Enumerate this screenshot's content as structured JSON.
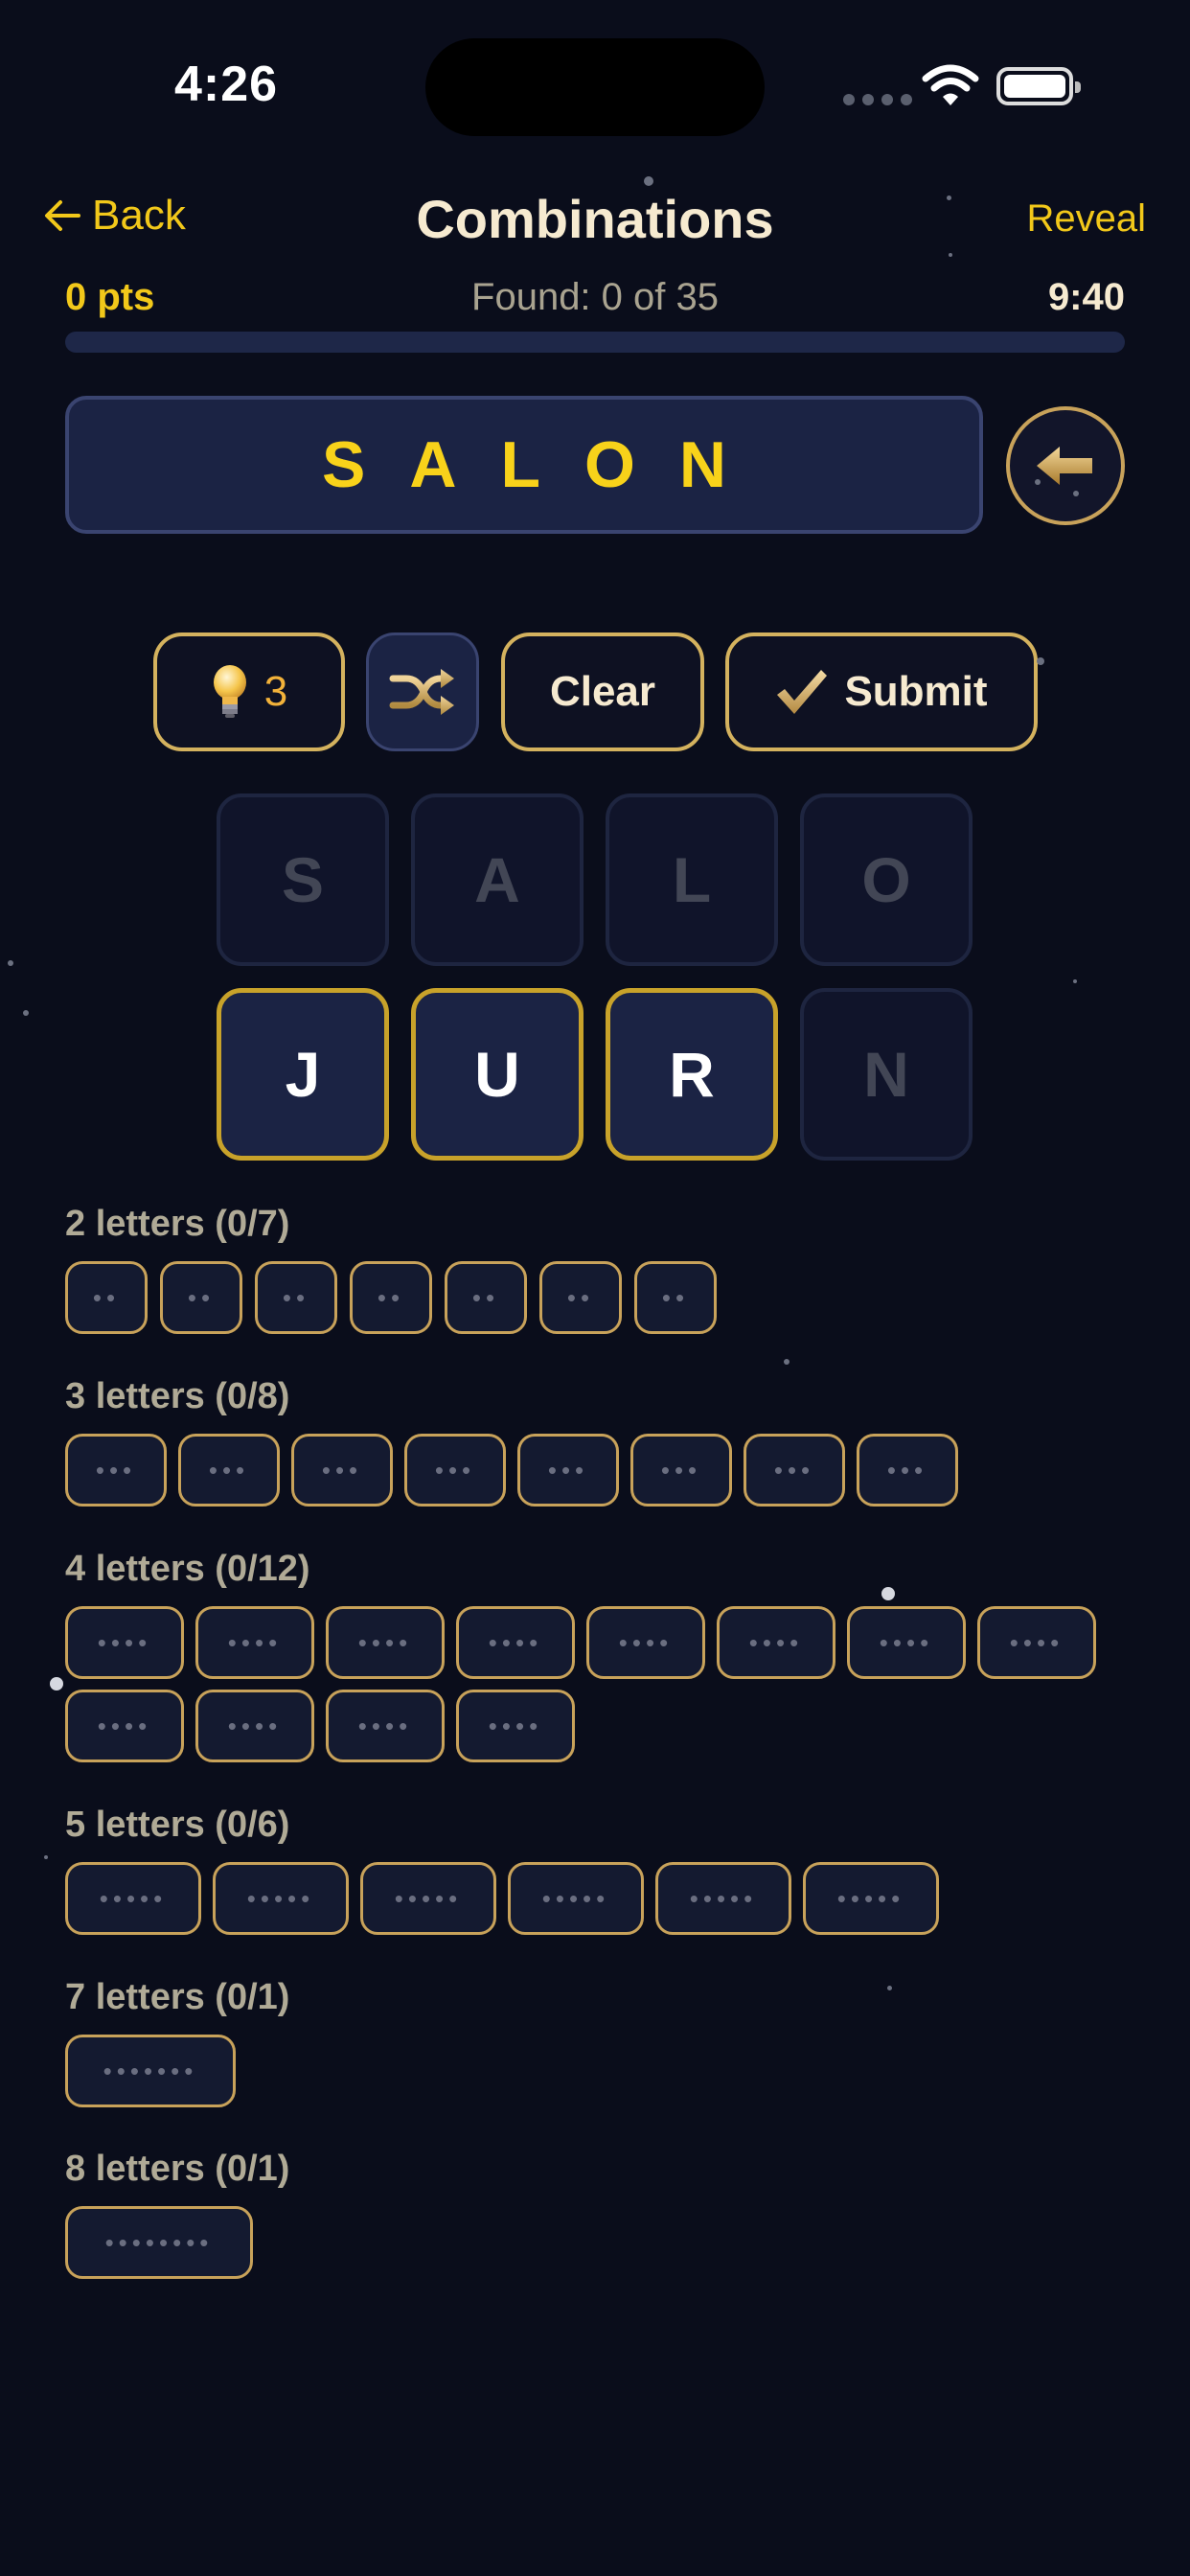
{
  "status": {
    "time": "4:26"
  },
  "header": {
    "back_label": "Back",
    "title": "Combinations",
    "reveal_label": "Reveal"
  },
  "stats": {
    "points": "0 pts",
    "found": "Found: 0 of 35",
    "timer": "9:40",
    "progress": 0
  },
  "word": {
    "current": "SALON"
  },
  "actions": {
    "hint_count": "3",
    "clear_label": "Clear",
    "submit_label": "Submit"
  },
  "tiles": [
    {
      "letter": "S",
      "state": "used"
    },
    {
      "letter": "A",
      "state": "used"
    },
    {
      "letter": "L",
      "state": "used"
    },
    {
      "letter": "O",
      "state": "used"
    },
    {
      "letter": "J",
      "state": "active"
    },
    {
      "letter": "U",
      "state": "active"
    },
    {
      "letter": "R",
      "state": "active"
    },
    {
      "letter": "N",
      "state": "used"
    }
  ],
  "groups": [
    {
      "label": "2 letters (0/7)",
      "length": 2,
      "count": 7
    },
    {
      "label": "3 letters (0/8)",
      "length": 3,
      "count": 8
    },
    {
      "label": "4 letters (0/12)",
      "length": 4,
      "count": 12
    },
    {
      "label": "5 letters (0/6)",
      "length": 5,
      "count": 6
    },
    {
      "label": "7 letters (0/1)",
      "length": 7,
      "count": 1
    },
    {
      "label": "8 letters (0/1)",
      "length": 8,
      "count": 1
    }
  ],
  "colors": {
    "background": "#0a0d1b",
    "accent_gold": "#f2c81a",
    "tile_border_active": "#c8a22a",
    "slot_border": "#c8a25a"
  },
  "icons": [
    "wifi-icon",
    "battery-icon",
    "arrow-left-icon",
    "backspace-arrow-icon",
    "lightbulb-icon",
    "shuffle-icon",
    "checkmark-icon"
  ]
}
